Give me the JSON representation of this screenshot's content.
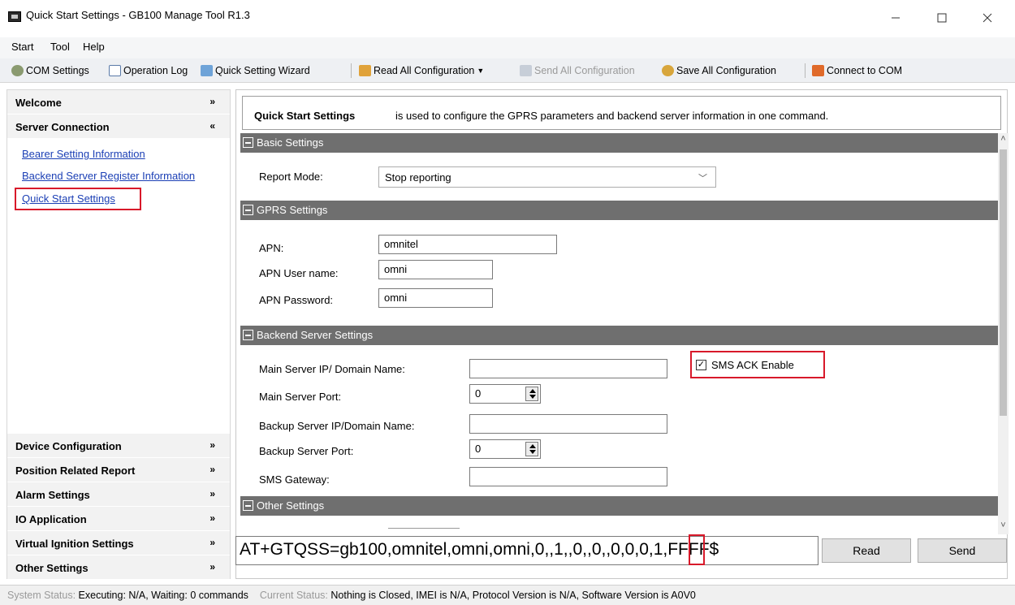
{
  "window": {
    "title": "Quick Start Settings - GB100 Manage Tool R1.3"
  },
  "menu": [
    "Start",
    "Tool",
    "Help"
  ],
  "toolbar": {
    "com_settings": "COM Settings",
    "operation_log": "Operation Log",
    "quick_setting_wizard": "Quick Setting Wizard",
    "read_all": "Read All Configuration",
    "send_all": "Send All Configuration",
    "save_all": "Save All Configuration",
    "connect_com": "Connect to COM"
  },
  "sidebar": {
    "top_sections": [
      {
        "label": "Welcome",
        "chevron": "»"
      },
      {
        "label": "Server Connection",
        "chevron": "«"
      }
    ],
    "links": [
      "Bearer Setting Information",
      "Backend Server Register Information",
      "Quick Start Settings"
    ],
    "bottom_sections": [
      "Device Configuration",
      "Position Related Report",
      "Alarm Settings",
      "IO Application",
      "Virtual Ignition Settings",
      "Other Settings"
    ]
  },
  "header": {
    "title": "Quick Start Settings",
    "description": "is used to configure the GPRS parameters and backend server information in one command."
  },
  "sections": {
    "basic": "Basic Settings",
    "gprs": "GPRS Settings",
    "backend": "Backend Server Settings",
    "other": "Other Settings"
  },
  "basic": {
    "report_mode_label": "Report Mode:",
    "report_mode_value": "Stop reporting"
  },
  "gprs": {
    "apn_label": "APN:",
    "apn_value": "omnitel",
    "user_label": "APN User name:",
    "user_value": "omni",
    "password_label": "APN Password:",
    "password_value": "omni"
  },
  "backend": {
    "main_ip_label": "Main Server IP/ Domain Name:",
    "main_ip_value": "",
    "main_port_label": "Main Server Port:",
    "main_port_value": "0",
    "backup_ip_label": "Backup Server IP/Domain Name:",
    "backup_ip_value": "",
    "backup_port_label": "Backup Server Port:",
    "backup_port_value": "0",
    "sms_gateway_label": "SMS Gateway:",
    "sms_gateway_value": "",
    "sms_ack_label": "SMS ACK Enable",
    "sms_ack_checked": true
  },
  "command": {
    "text": "AT+GTQSS=gb100,omnitel,omni,omni,0,,1,,0,,0,,0,0,0,1,FFFF$",
    "read_label": "Read",
    "send_label": "Send"
  },
  "status": {
    "system_label": "System Status:",
    "system_value": "Executing: N/A, Waiting: 0 commands",
    "current_label": "Current Status:",
    "current_value": "Nothing is Closed, IMEI is N/A, Protocol Version is N/A, Software Version is A0V0"
  }
}
